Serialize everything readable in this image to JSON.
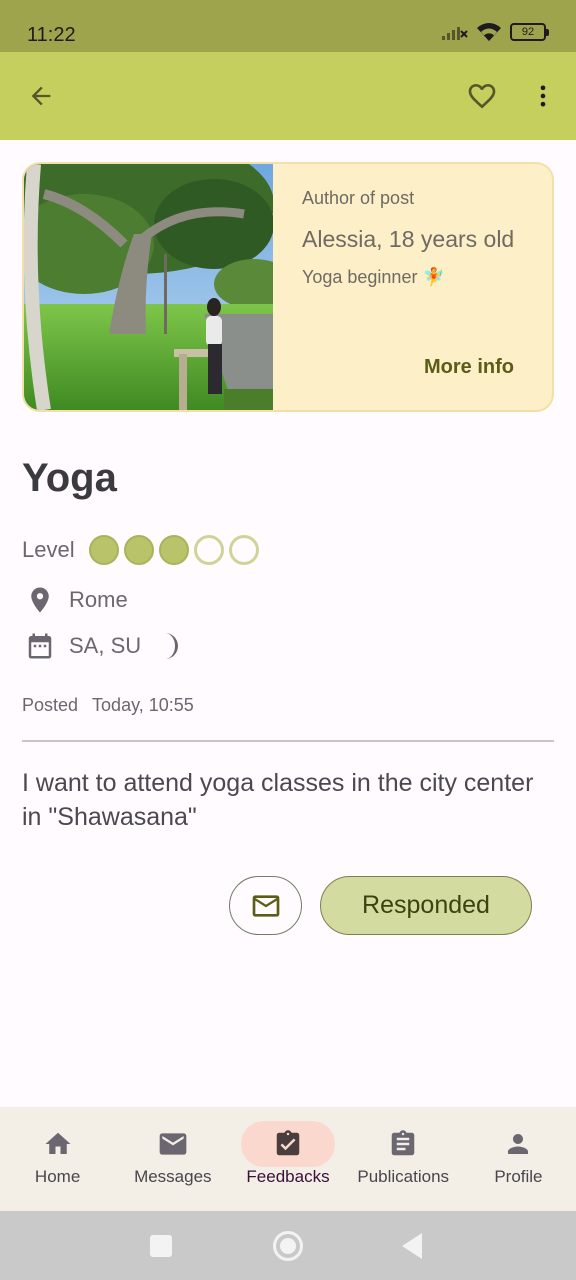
{
  "status": {
    "time": "11:22",
    "battery": "92"
  },
  "author": {
    "label": "Author of post",
    "name": "Alessia, 18 years old",
    "desc": "Yoga beginner 🧚",
    "more": "More info"
  },
  "post": {
    "title": "Yoga",
    "level_label": "Level",
    "level": {
      "value": 3,
      "max": 5
    },
    "location": "Rome",
    "days": "SA, SU",
    "posted_label": "Posted",
    "posted_time": "Today, 10:55",
    "description": "I want to attend yoga classes in the city center in \"Shawasana\"",
    "responded_label": "Responded"
  },
  "nav": [
    {
      "label": "Home",
      "icon": "home-icon"
    },
    {
      "label": "Messages",
      "icon": "mail-icon"
    },
    {
      "label": "Feedbacks",
      "icon": "clipboard-check-icon",
      "active": true
    },
    {
      "label": "Publications",
      "icon": "clipboard-list-icon"
    },
    {
      "label": "Profile",
      "icon": "person-icon"
    }
  ],
  "colors": {
    "app_bar": "#c5cf5e",
    "status_bar": "#9ea44c",
    "card_bg": "#fdefc7",
    "accent_fill": "#b9c46a",
    "button_fill": "#d3dba0",
    "active_nav": "#fbd8cd"
  }
}
